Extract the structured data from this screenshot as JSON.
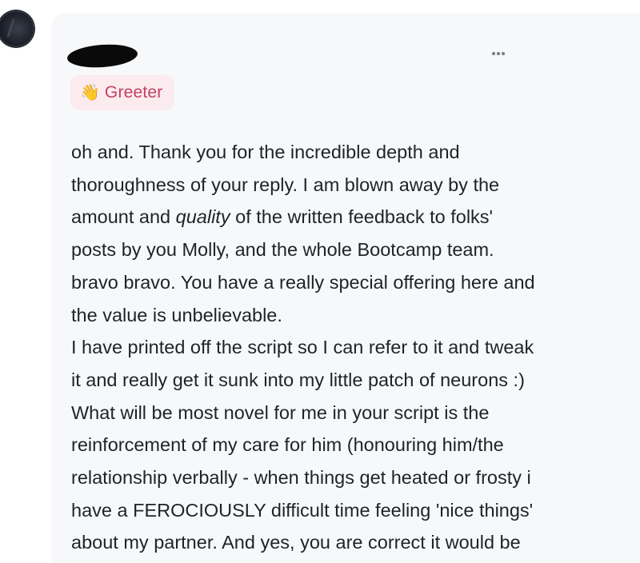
{
  "post": {
    "author_redacted": true,
    "more_options_icon": "ellipsis-horizontal-icon",
    "badge": {
      "icon": "waving-hand-icon",
      "icon_glyph": "👋",
      "label": "Greeter",
      "background": "#fbebee",
      "text_color": "#c2416a"
    },
    "body_lines": [
      {
        "segments": [
          {
            "text": "oh and. Thank you for the incredible depth and"
          }
        ]
      },
      {
        "segments": [
          {
            "text": "thoroughness of your reply. I am blown away by the"
          }
        ]
      },
      {
        "segments": [
          {
            "text": "amount and "
          },
          {
            "text": "quality",
            "italic": true
          },
          {
            "text": " of the written feedback to folks'"
          }
        ]
      },
      {
        "segments": [
          {
            "text": "posts by you Molly, and the whole Bootcamp team."
          }
        ]
      },
      {
        "segments": [
          {
            "text": "bravo bravo. You have a really special offering here and"
          }
        ]
      },
      {
        "segments": [
          {
            "text": "the value is unbelievable."
          }
        ]
      },
      {
        "segments": [
          {
            "text": "I have printed off the script so I can refer to it and tweak"
          }
        ]
      },
      {
        "segments": [
          {
            "text": "it and really get it sunk into my little patch of neurons :)"
          }
        ]
      },
      {
        "segments": [
          {
            "text": "What will be most novel for me in your script is the"
          }
        ]
      },
      {
        "segments": [
          {
            "text": "reinforcement of my care for him (honouring him/the"
          }
        ]
      },
      {
        "segments": [
          {
            "text": "relationship verbally - when things get heated or frosty i"
          }
        ]
      },
      {
        "segments": [
          {
            "text": "have a FEROCIOUSLY difficult time feeling 'nice things'"
          }
        ]
      },
      {
        "segments": [
          {
            "text": "about my partner. And yes, you are correct it would be"
          }
        ]
      }
    ]
  },
  "colors": {
    "card_background": "#f7f8fa",
    "body_text": "#1f2328"
  }
}
